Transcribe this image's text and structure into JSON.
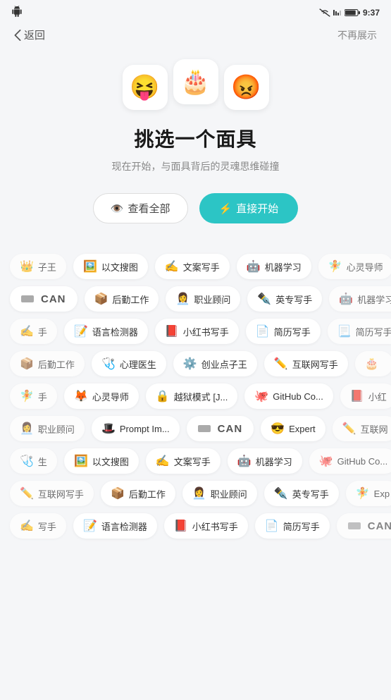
{
  "statusBar": {
    "leftIcon": "android-icon",
    "time": "9:37",
    "signalIcon": "signal-icon",
    "batteryIcon": "battery-icon"
  },
  "nav": {
    "backLabel": "返回",
    "noShowLabel": "不再展示"
  },
  "hero": {
    "emojis": [
      "😝",
      "🎂",
      "😡"
    ],
    "title": "挑选一个面具",
    "subtitle": "现在开始，与面具背后的灵魂思维碰撞",
    "viewAllLabel": "查看全部",
    "startLabel": "直接开始"
  },
  "rows": [
    [
      {
        "icon": "👑",
        "label": "子王",
        "partial": true
      },
      {
        "icon": "🖼️",
        "label": "以文搜图"
      },
      {
        "icon": "✍️",
        "label": "文案写手"
      },
      {
        "icon": "🤖",
        "label": "机器学习"
      },
      {
        "icon": "🧚",
        "label": "心灵导师",
        "partial": true
      }
    ],
    [
      {
        "can": true,
        "label": "CAN"
      },
      {
        "icon": "📦",
        "label": "后勤工作"
      },
      {
        "icon": "👩‍💼",
        "label": "职业顾问"
      },
      {
        "icon": "✒️",
        "label": "英专写手"
      },
      {
        "icon": "🤖",
        "label": "机器学习",
        "partial": true
      }
    ],
    [
      {
        "icon": "✍️",
        "label": "手",
        "partial": true
      },
      {
        "icon": "📝",
        "label": "语言检测器"
      },
      {
        "icon": "📕",
        "label": "小红书写手"
      },
      {
        "icon": "📄",
        "label": "简历写手"
      },
      {
        "icon": "📃",
        "label": "简历写手",
        "partial": true
      }
    ],
    [
      {
        "icon": "📦",
        "label": "后勤工作",
        "partial": true
      },
      {
        "icon": "🩺",
        "label": "心理医生"
      },
      {
        "icon": "⚙️",
        "label": "创业点子王"
      },
      {
        "icon": "✏️",
        "label": "互联网写手"
      },
      {
        "icon": "🎂",
        "label": "",
        "partial": true
      }
    ],
    [
      {
        "icon": "🧚",
        "label": "手",
        "partial": true
      },
      {
        "icon": "🦊",
        "label": "心灵导师"
      },
      {
        "icon": "🔒",
        "label": "越狱模式 [J..."
      },
      {
        "icon": "🐙",
        "label": "GitHub Co..."
      },
      {
        "icon": "📕",
        "label": "小红",
        "partial": true
      }
    ],
    [
      {
        "icon": "👩‍💼",
        "label": "职业顾问",
        "partial": true
      },
      {
        "icon": "🎩",
        "label": "Prompt Im..."
      },
      {
        "can": true,
        "label": "CAN"
      },
      {
        "icon": "😎",
        "label": "Expert"
      },
      {
        "icon": "✏️",
        "label": "互联网",
        "partial": true
      }
    ],
    [
      {
        "icon": "🩺",
        "label": "生",
        "partial": true
      },
      {
        "icon": "🖼️",
        "label": "以文搜图"
      },
      {
        "icon": "✍️",
        "label": "文案写手"
      },
      {
        "icon": "🤖",
        "label": "机器学习"
      },
      {
        "icon": "🐙",
        "label": "GitHub Co...",
        "partial": true
      }
    ],
    [
      {
        "icon": "✏️",
        "label": "互联网写手",
        "partial": true
      },
      {
        "icon": "📦",
        "label": "后勤工作"
      },
      {
        "icon": "👩‍💼",
        "label": "职业顾问"
      },
      {
        "icon": "✒️",
        "label": "英专写手"
      },
      {
        "icon": "🧚",
        "label": "Exp",
        "partial": true
      }
    ],
    [
      {
        "icon": "✍️",
        "label": "写手",
        "partial": true
      },
      {
        "icon": "📝",
        "label": "语言检测器"
      },
      {
        "icon": "📕",
        "label": "小红书写手"
      },
      {
        "icon": "📄",
        "label": "简历写手"
      },
      {
        "can": true,
        "label": "CAN",
        "partial": true
      }
    ]
  ]
}
